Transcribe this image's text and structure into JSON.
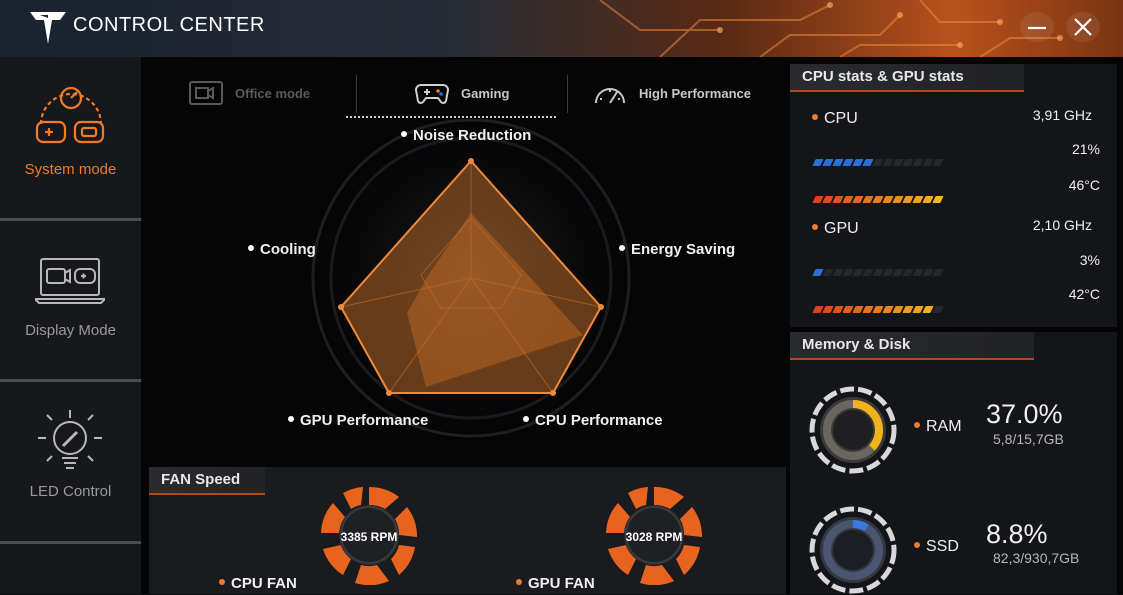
{
  "app": {
    "title": "CONTROL CENTER"
  },
  "sidebar": {
    "items": [
      {
        "label": "System mode",
        "icon": "gamepad-gauge-icon",
        "active": true
      },
      {
        "label": "Display Mode",
        "icon": "laptop-display-icon",
        "active": false
      },
      {
        "label": "LED Control",
        "icon": "led-bulb-icon",
        "active": false
      }
    ]
  },
  "modes": [
    {
      "label": "Office mode",
      "icon": "video-window-icon",
      "state": "disabled"
    },
    {
      "label": "Gaming",
      "icon": "gamepad-icon",
      "state": "selected"
    },
    {
      "label": "High Performance",
      "icon": "speedometer-icon",
      "state": "normal"
    }
  ],
  "radar": {
    "axes": [
      "Noise Reduction",
      "Energy Saving",
      "CPU Performance",
      "GPU Performance",
      "Cooling"
    ]
  },
  "fan": {
    "title": "FAN Speed",
    "cpu": {
      "label": "CPU FAN",
      "rpm": "3385 RPM"
    },
    "gpu": {
      "label": "GPU FAN",
      "rpm": "3028 RPM"
    }
  },
  "stats": {
    "title": "CPU stats & GPU stats",
    "cpu": {
      "label": "CPU",
      "clock": "3,91 GHz",
      "usage": "21%",
      "usage_value": 0.21,
      "temp": "46°C",
      "temp_fraction": 0.46
    },
    "gpu": {
      "label": "GPU",
      "clock": "2,10 GHz",
      "usage": "3%",
      "usage_value": 0.03,
      "temp": "42°C",
      "temp_fraction": 0.42
    }
  },
  "memory": {
    "title": "Memory & Disk",
    "ram": {
      "label": "RAM",
      "percent": "37.0%",
      "percent_value": 37.0,
      "detail": "5,8/15,7GB"
    },
    "ssd": {
      "label": "SSD",
      "percent": "8.8%",
      "percent_value": 8.8,
      "detail": "82,3/930,7GB"
    }
  },
  "colors": {
    "accent": "#f07a2a",
    "usage_bar": "#2a6fd6",
    "temp_bar_start": "#e0401a",
    "temp_bar_end": "#f2b81a"
  }
}
